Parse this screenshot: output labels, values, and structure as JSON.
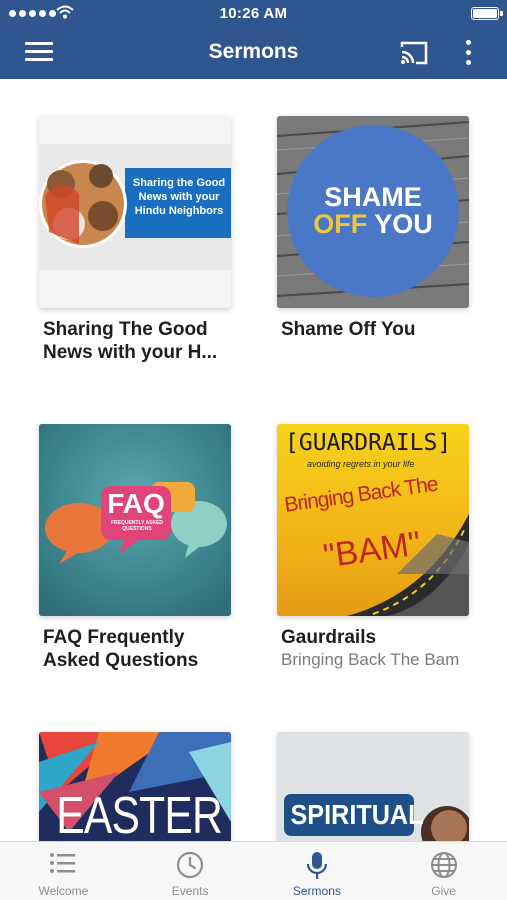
{
  "status_bar": {
    "time": "10:26 AM"
  },
  "header": {
    "title": "Sermons"
  },
  "sermons": [
    {
      "title": "Sharing The Good News with your H...",
      "subtitle": "",
      "thumb_text": "Sharing the Good News with your Hindu Neighbors"
    },
    {
      "title": "Shame Off You",
      "subtitle": "",
      "thumb_line1": "SHAME",
      "thumb_line2a": "OFF",
      "thumb_line2b": "YOU"
    },
    {
      "title": "FAQ Frequently Asked Questions",
      "subtitle": "",
      "thumb_line1": "FAQ",
      "thumb_line2": "FREQUENTLY ASKED",
      "thumb_line3": "QUESTIONS"
    },
    {
      "title": "Gaurdrails",
      "subtitle": "Bringing Back The Bam",
      "thumb_header": "[GUARDRAILS]",
      "thumb_tagline": "avoiding regrets in your life",
      "thumb_line1": "Bringing Back The",
      "thumb_line2": "\"BAM\""
    },
    {
      "title": "",
      "subtitle": "",
      "thumb_text": "EASTER"
    },
    {
      "title": "",
      "subtitle": "",
      "thumb_text": "SPIRITUAL"
    }
  ],
  "tabs": [
    {
      "label": "Welcome",
      "icon": "list-icon",
      "active": false
    },
    {
      "label": "Events",
      "icon": "clock-icon",
      "active": false
    },
    {
      "label": "Sermons",
      "icon": "microphone-icon",
      "active": true
    },
    {
      "label": "Give",
      "icon": "globe-icon",
      "active": false
    }
  ],
  "colors": {
    "nav_bar": "#2f568f",
    "active_tab": "#2f568f",
    "inactive_tab": "#8e8e8e"
  }
}
